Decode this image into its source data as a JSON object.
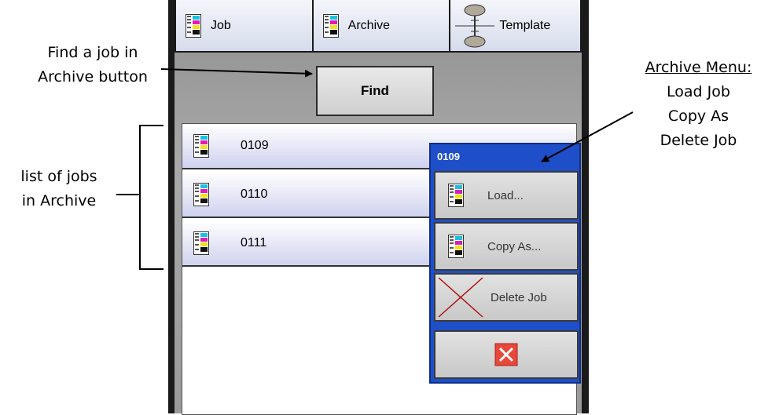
{
  "tabs": [
    {
      "label": "Job",
      "icon": "job-document-icon"
    },
    {
      "label": "Archive",
      "icon": "job-document-icon"
    },
    {
      "label": "Template",
      "icon": "template-flow-icon"
    }
  ],
  "find_button": {
    "label": "Find"
  },
  "jobs": [
    {
      "name": "0109"
    },
    {
      "name": "0110"
    },
    {
      "name": "0111"
    }
  ],
  "context_menu": {
    "title": "0109",
    "items": [
      {
        "label": "Load...",
        "icon": "job-document-icon"
      },
      {
        "label": "Copy As...",
        "icon": "job-document-icon"
      },
      {
        "label": "Delete Job",
        "icon": "delete-cross-icon"
      }
    ],
    "close_icon": "close-icon"
  },
  "callouts": {
    "find": {
      "line1": "Find a job in",
      "line2": "Archive button"
    },
    "list": {
      "line1": "list of jobs",
      "line2": "in Archive"
    },
    "archive_menu": {
      "title": "Archive Menu:",
      "line1": "Load Job",
      "line2": "Copy As",
      "line3": "Delete Job"
    }
  },
  "colors": {
    "menu_blue": "#1f4fc8",
    "delete_red": "#b01010",
    "close_red": "#e8473b"
  }
}
